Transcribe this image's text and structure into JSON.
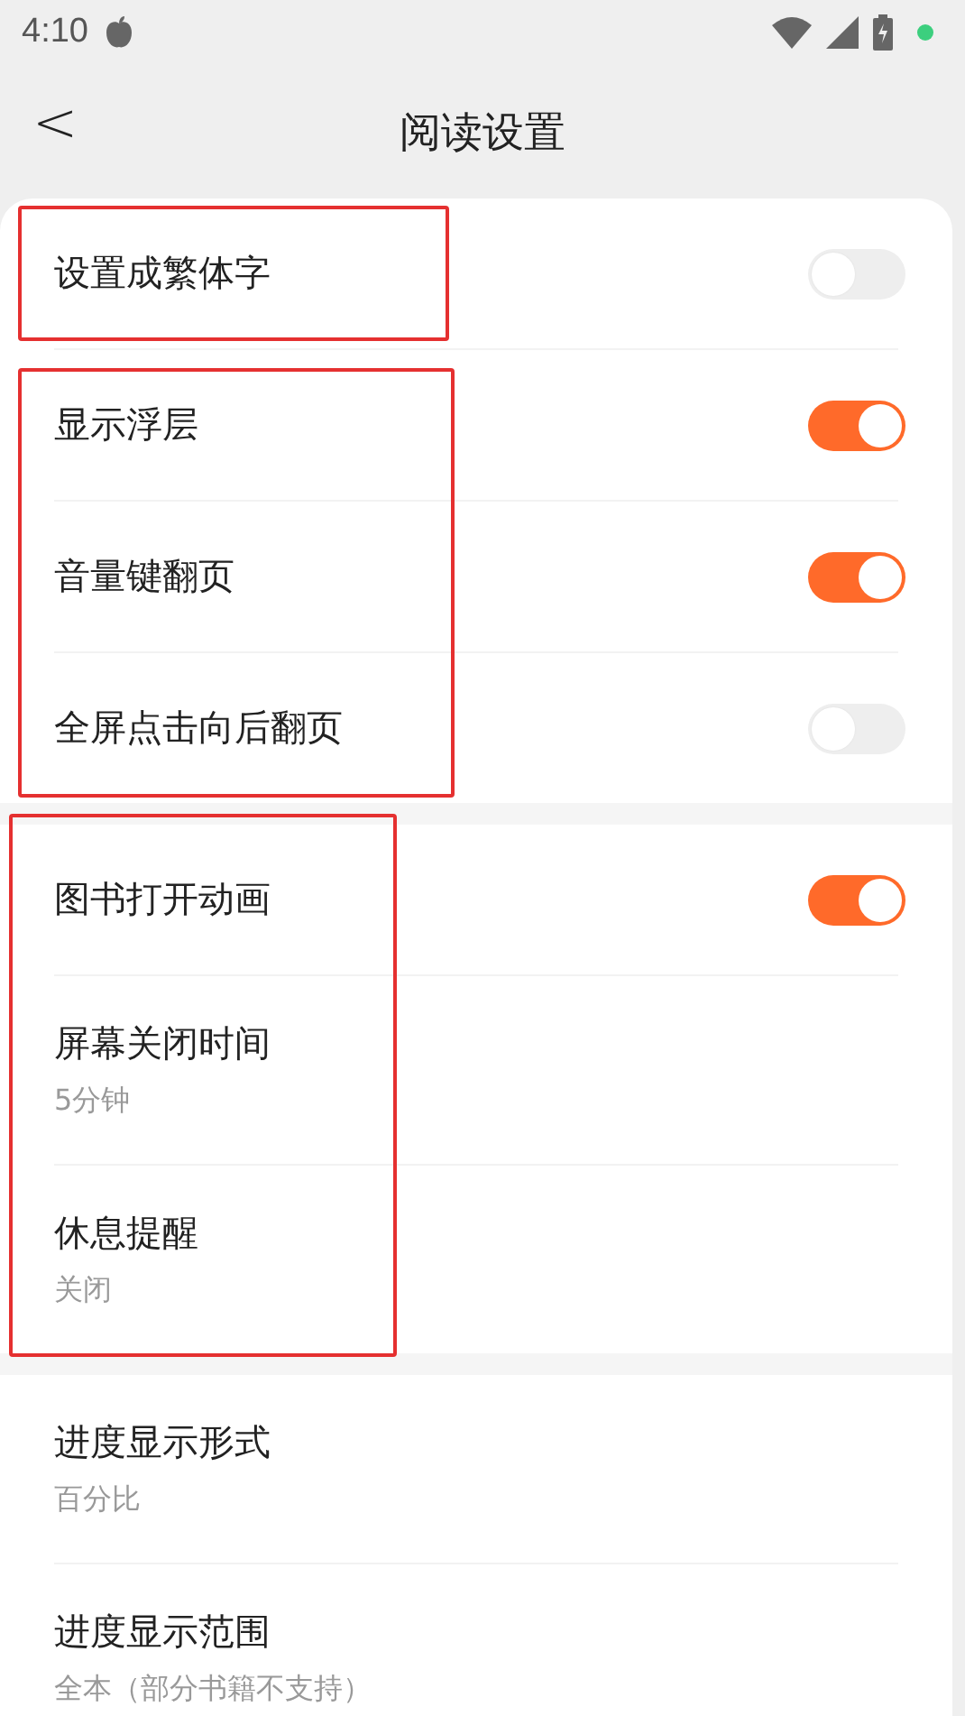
{
  "status_bar": {
    "time": "4:10"
  },
  "header": {
    "back": "<",
    "title": "阅读设置"
  },
  "groups": [
    {
      "rows": [
        {
          "kind": "toggle",
          "label": "设置成繁体字",
          "on": false
        },
        {
          "kind": "toggle",
          "label": "显示浮层",
          "on": true
        },
        {
          "kind": "toggle",
          "label": "音量键翻页",
          "on": true
        },
        {
          "kind": "toggle",
          "label": "全屏点击向后翻页",
          "on": false
        }
      ]
    },
    {
      "rows": [
        {
          "kind": "toggle",
          "label": "图书打开动画",
          "on": true
        },
        {
          "kind": "value",
          "label": "屏幕关闭时间",
          "value": "5分钟"
        },
        {
          "kind": "value",
          "label": "休息提醒",
          "value": "关闭"
        }
      ]
    },
    {
      "rows": [
        {
          "kind": "value",
          "label": "进度显示形式",
          "value": "百分比"
        },
        {
          "kind": "value",
          "label": "进度显示范围",
          "value": "全本（部分书籍不支持）"
        }
      ]
    }
  ]
}
